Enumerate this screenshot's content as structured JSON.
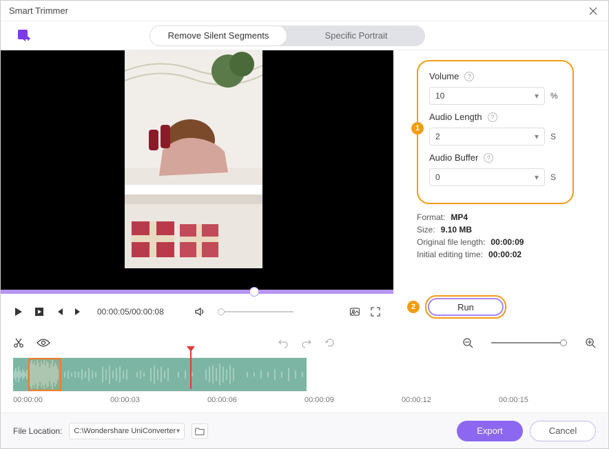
{
  "window": {
    "title": "Smart Trimmer"
  },
  "tabs": {
    "remove": "Remove Silent Segments",
    "portrait": "Specific Portrait"
  },
  "settings": {
    "volume_label": "Volume",
    "volume_value": "10",
    "volume_unit": "%",
    "audio_length_label": "Audio Length",
    "audio_length_value": "2",
    "audio_length_unit": "S",
    "audio_buffer_label": "Audio Buffer",
    "audio_buffer_value": "0",
    "audio_buffer_unit": "S"
  },
  "info": {
    "format_label": "Format:",
    "format_value": "MP4",
    "size_label": "Size:",
    "size_value": "9.10 MB",
    "orig_len_label": "Original file length:",
    "orig_len_value": "00:00:09",
    "edit_time_label": "Initial editing time:",
    "edit_time_value": "00:00:02"
  },
  "run_label": "Run",
  "badges": {
    "one": "1",
    "two": "2"
  },
  "player": {
    "time_current": "00:00:05",
    "time_total": "00:00:08"
  },
  "timeline": {
    "t0": "00:00:00",
    "t1": "00:00:03",
    "t2": "00:00:06",
    "t3": "00:00:09",
    "t4": "00:00:12",
    "t5": "00:00:15"
  },
  "bottom": {
    "file_label": "File Location:",
    "file_path": "C:\\Wondershare UniConverter",
    "export": "Export",
    "cancel": "Cancel"
  }
}
